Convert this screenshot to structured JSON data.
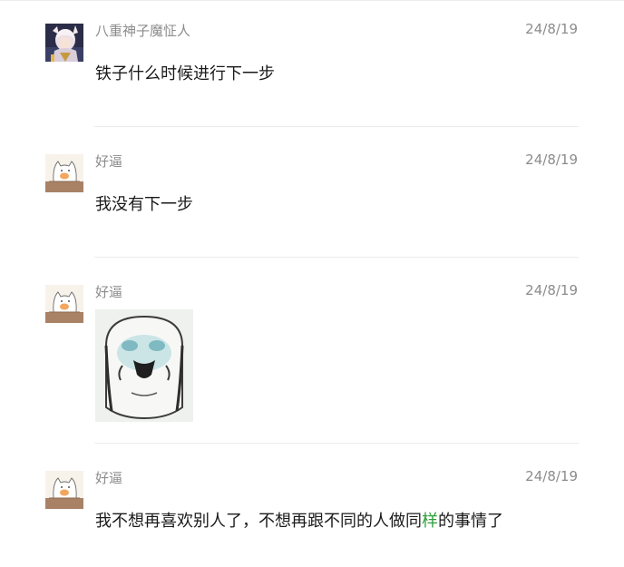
{
  "messages": [
    {
      "avatar_icon": "anime-character-avatar-icon",
      "name": "八重神子魔怔人",
      "time": "24/8/19",
      "text": "铁子什么时候进行下一步"
    },
    {
      "avatar_icon": "cat-avatar-icon",
      "name": "好逼",
      "time": "24/8/19",
      "text": "我没有下一步"
    },
    {
      "avatar_icon": "cat-avatar-icon",
      "name": "好逼",
      "time": "24/8/19",
      "sticker_icon": "meme-face-sticker-icon"
    },
    {
      "avatar_icon": "cat-avatar-icon",
      "name": "好逼",
      "time": "24/8/19",
      "text_before": "我不想再喜欢别人了，不想再跟不同的人做同",
      "text_highlight": "样",
      "text_after": "的事情了"
    }
  ],
  "colors": {
    "name": "#8c8c8c",
    "time": "#8c8c8c",
    "text": "#1a1a1a",
    "highlight": "#2e9f3a",
    "divider": "#ececec"
  }
}
